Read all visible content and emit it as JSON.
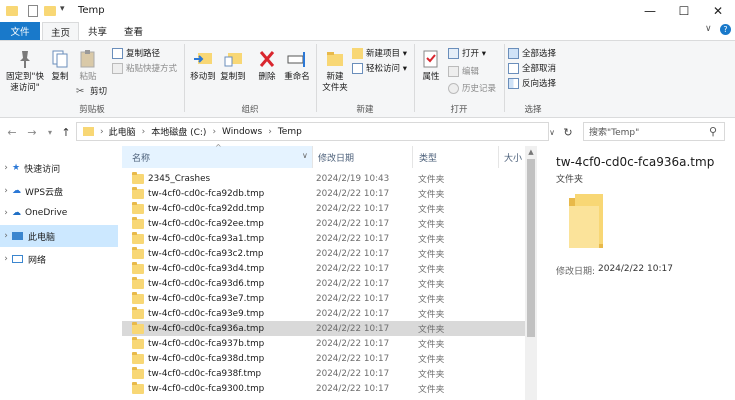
{
  "window": {
    "title": "Temp",
    "minimize": "—",
    "maximize": "☐",
    "close": "✕"
  },
  "tabs": [
    {
      "label": "文件"
    },
    {
      "label": "主页"
    },
    {
      "label": "共享"
    },
    {
      "label": "查看"
    }
  ],
  "ribbon": {
    "clipboard": {
      "pin_label": "固定到\"快速访问\"",
      "copy_label": "复制",
      "paste_label": "粘贴",
      "copy_path": "复制路径",
      "paste_shortcut": "粘贴快捷方式",
      "cut": "剪切",
      "group": "剪贴板"
    },
    "organize": {
      "move_to": "移动到",
      "copy_to": "复制到",
      "delete": "删除",
      "rename": "重命名",
      "group": "组织"
    },
    "new": {
      "new_folder": "新建\n文件夹",
      "new_item": "新建项目 ▾",
      "easy_access": "轻松访问 ▾",
      "group": "新建"
    },
    "open": {
      "properties": "属性",
      "open": "打开 ▾",
      "edit": "编辑",
      "history": "历史记录",
      "group": "打开"
    },
    "select": {
      "select_all": "全部选择",
      "select_none": "全部取消",
      "invert": "反向选择",
      "group": "选择"
    }
  },
  "address": {
    "segments": [
      "此电脑",
      "本地磁盘 (C:)",
      "Windows",
      "Temp"
    ],
    "search_placeholder": "搜索\"Temp\""
  },
  "nav": [
    {
      "label": "快速访问",
      "icon": "star-icon",
      "color": "#2b78d6"
    },
    {
      "label": "WPS云盘",
      "icon": "cloud-icon",
      "color": "#2b78d6"
    },
    {
      "label": "OneDrive",
      "icon": "onedrive-icon",
      "color": "#1f6fc5"
    },
    {
      "label": "此电脑",
      "icon": "computer-icon",
      "color": "#3b86cf"
    },
    {
      "label": "网络",
      "icon": "network-icon",
      "color": "#3b86cf"
    }
  ],
  "columns": {
    "name": "名称",
    "date": "修改日期",
    "type": "类型",
    "size": "大小"
  },
  "files": [
    {
      "name": "2345_Crashes",
      "date": "2024/2/19 10:43",
      "type": "文件夹"
    },
    {
      "name": "tw-4cf0-cd0c-fca92db.tmp",
      "date": "2024/2/22 10:17",
      "type": "文件夹"
    },
    {
      "name": "tw-4cf0-cd0c-fca92dd.tmp",
      "date": "2024/2/22 10:17",
      "type": "文件夹"
    },
    {
      "name": "tw-4cf0-cd0c-fca92ee.tmp",
      "date": "2024/2/22 10:17",
      "type": "文件夹"
    },
    {
      "name": "tw-4cf0-cd0c-fca93a1.tmp",
      "date": "2024/2/22 10:17",
      "type": "文件夹"
    },
    {
      "name": "tw-4cf0-cd0c-fca93c2.tmp",
      "date": "2024/2/22 10:17",
      "type": "文件夹"
    },
    {
      "name": "tw-4cf0-cd0c-fca93d4.tmp",
      "date": "2024/2/22 10:17",
      "type": "文件夹"
    },
    {
      "name": "tw-4cf0-cd0c-fca93d6.tmp",
      "date": "2024/2/22 10:17",
      "type": "文件夹"
    },
    {
      "name": "tw-4cf0-cd0c-fca93e7.tmp",
      "date": "2024/2/22 10:17",
      "type": "文件夹"
    },
    {
      "name": "tw-4cf0-cd0c-fca93e9.tmp",
      "date": "2024/2/22 10:17",
      "type": "文件夹"
    },
    {
      "name": "tw-4cf0-cd0c-fca936a.tmp",
      "date": "2024/2/22 10:17",
      "type": "文件夹",
      "selected": true
    },
    {
      "name": "tw-4cf0-cd0c-fca937b.tmp",
      "date": "2024/2/22 10:17",
      "type": "文件夹"
    },
    {
      "name": "tw-4cf0-cd0c-fca938d.tmp",
      "date": "2024/2/22 10:17",
      "type": "文件夹"
    },
    {
      "name": "tw-4cf0-cd0c-fca938f.tmp",
      "date": "2024/2/22 10:17",
      "type": "文件夹"
    },
    {
      "name": "tw-4cf0-cd0c-fca9300.tmp",
      "date": "2024/2/22 10:17",
      "type": "文件夹"
    }
  ],
  "preview": {
    "name": "tw-4cf0-cd0c-fca936a.tmp",
    "type": "文件夹",
    "modified_label": "修改日期:",
    "modified_value": "2024/2/22 10:17"
  },
  "colors": {
    "accent": "#1979ca",
    "selection": "#d9d9d9",
    "nav_selection": "#cce8ff",
    "folder": "#f8d775"
  }
}
